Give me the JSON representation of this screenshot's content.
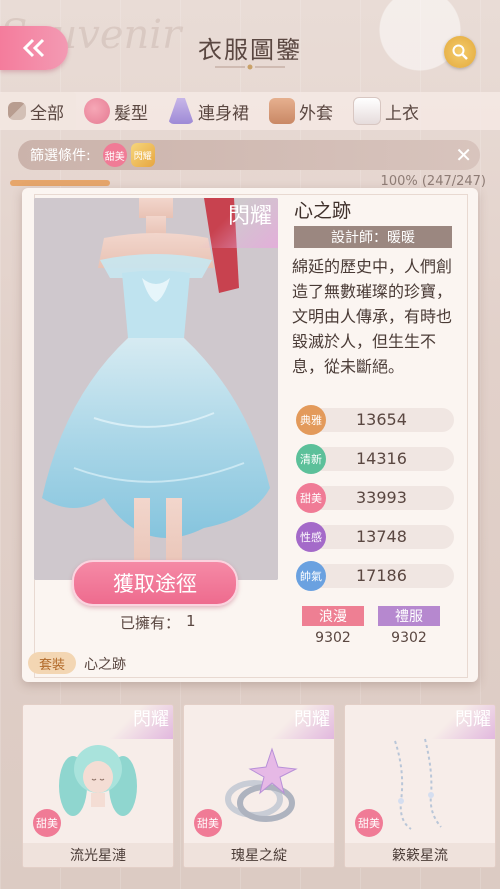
{
  "header": {
    "title": "衣服圖鑒",
    "watermark": "Souvenir"
  },
  "tabs": [
    {
      "label": "全部"
    },
    {
      "label": "髮型"
    },
    {
      "label": "連身裙"
    },
    {
      "label": "外套"
    },
    {
      "label": "上衣"
    }
  ],
  "filter": {
    "label": "篩選條件:",
    "tag1": "甜美",
    "tag2": "閃耀",
    "close": "✕"
  },
  "progress": {
    "text": "100% (247/247)",
    "fraction": 1.0
  },
  "detail": {
    "shine_badge": "閃耀",
    "name": "心之跡",
    "designer": "設計師：暖暖",
    "description": "綿延的歷史中，人們創造了無數璀璨的珍寶，文明由人傳承，有時也毀滅於人，但生生不息，從未斷絕。",
    "acquire_button": "獲取途徑",
    "owned_label": "已擁有：",
    "owned_value": "1",
    "suit_tag": "套裝",
    "suit_name": "心之跡",
    "attributes": [
      {
        "icon": "典雅",
        "value": "13654",
        "color": "#e39a5b"
      },
      {
        "icon": "清新",
        "value": "14316",
        "color": "#5cc09a"
      },
      {
        "icon": "甜美",
        "value": "33993",
        "color": "#f07b96"
      },
      {
        "icon": "性感",
        "value": "13748",
        "color": "#a46ac9"
      },
      {
        "icon": "帥氣",
        "value": "17186",
        "color": "#6aa1e0"
      }
    ],
    "styles": [
      {
        "label": "浪漫",
        "value": "9302",
        "color": "#ee7f93"
      },
      {
        "label": "禮服",
        "value": "9302",
        "color": "#b688cf"
      }
    ]
  },
  "bottom_items": [
    {
      "shine": "閃耀",
      "type": "甜美",
      "name": "流光星漣"
    },
    {
      "shine": "閃耀",
      "type": "甜美",
      "name": "瑰星之綻"
    },
    {
      "shine": "閃耀",
      "type": "甜美",
      "name": "簌簌星流"
    }
  ]
}
